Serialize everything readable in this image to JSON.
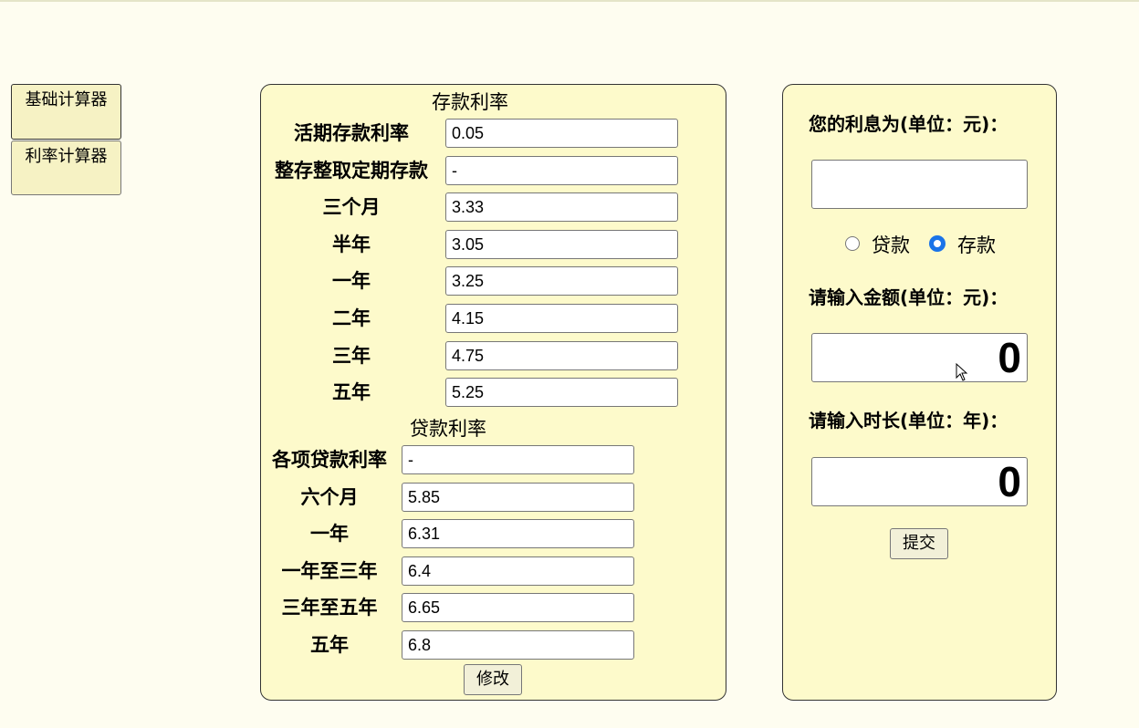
{
  "nav": {
    "basic_calc": "基础计算器",
    "rate_calc": "利率计算器"
  },
  "deposit": {
    "title": "存款利率",
    "rows": [
      {
        "label": "活期存款利率",
        "value": "0.05"
      },
      {
        "label": "整存整取定期存款",
        "value": "-"
      },
      {
        "label": "三个月",
        "value": "3.33"
      },
      {
        "label": "半年",
        "value": "3.05"
      },
      {
        "label": "一年",
        "value": "3.25"
      },
      {
        "label": "二年",
        "value": "4.15"
      },
      {
        "label": "三年",
        "value": "4.75"
      },
      {
        "label": "五年",
        "value": "5.25"
      }
    ]
  },
  "loan": {
    "title": "贷款利率",
    "rows": [
      {
        "label": "各项贷款利率",
        "value": "-"
      },
      {
        "label": "六个月",
        "value": "5.85"
      },
      {
        "label": "一年",
        "value": "6.31"
      },
      {
        "label": "一年至三年",
        "value": "6.4"
      },
      {
        "label": "三年至五年",
        "value": "6.65"
      },
      {
        "label": "五年",
        "value": "6.8"
      }
    ]
  },
  "modify_label": "修改",
  "calc": {
    "interest_label": "您的利息为(单位：元)：",
    "interest_value": "",
    "radio_loan": "贷款",
    "radio_deposit": "存款",
    "selected": "存款",
    "amount_label": "请输入金额(单位：元)：",
    "amount_value": "0",
    "duration_label": "请输入时长(单位：年)：",
    "duration_value": "0",
    "submit_label": "提交"
  }
}
